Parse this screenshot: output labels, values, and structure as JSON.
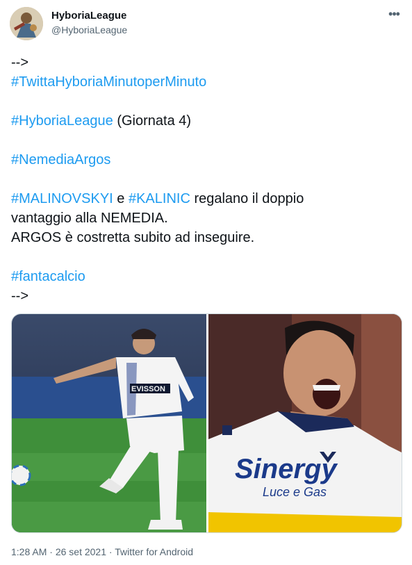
{
  "user": {
    "display_name": "HyboriaLeague",
    "handle": "@HyboriaLeague",
    "avatar_icon": "avatar-image"
  },
  "tweet": {
    "line1": "-->",
    "tag1": "#TwittaHyboriaMinutoperMinuto",
    "tag2": "#HyboriaLeague",
    "tag2_suffix": " (Giornata 4)",
    "tag3": "#NemediaArgos",
    "tag4": "#MALINOVSKYI",
    "mid1": " e ",
    "tag5": "#KALINIC",
    "mid2": " regalano il doppio",
    "line_b": "vantaggio alla NEMEDIA.",
    "line_c": "ARGOS è costretta subito ad inseguire.",
    "tag6": "#fantacalcio",
    "line_end": "-->"
  },
  "media": {
    "left_image": "player-left-photo",
    "right_image": "player-right-photo",
    "left_jersey_text": "EVISSON",
    "right_jersey_text": "Sinergy",
    "right_jersey_sub": "Luce e Gas"
  },
  "meta": {
    "time": "1:28 AM",
    "sep": " · ",
    "date": "26 set 2021",
    "source": "Twitter for Android"
  },
  "colors": {
    "link": "#1d9bf0",
    "muted": "#536471",
    "text": "#0f1419"
  }
}
